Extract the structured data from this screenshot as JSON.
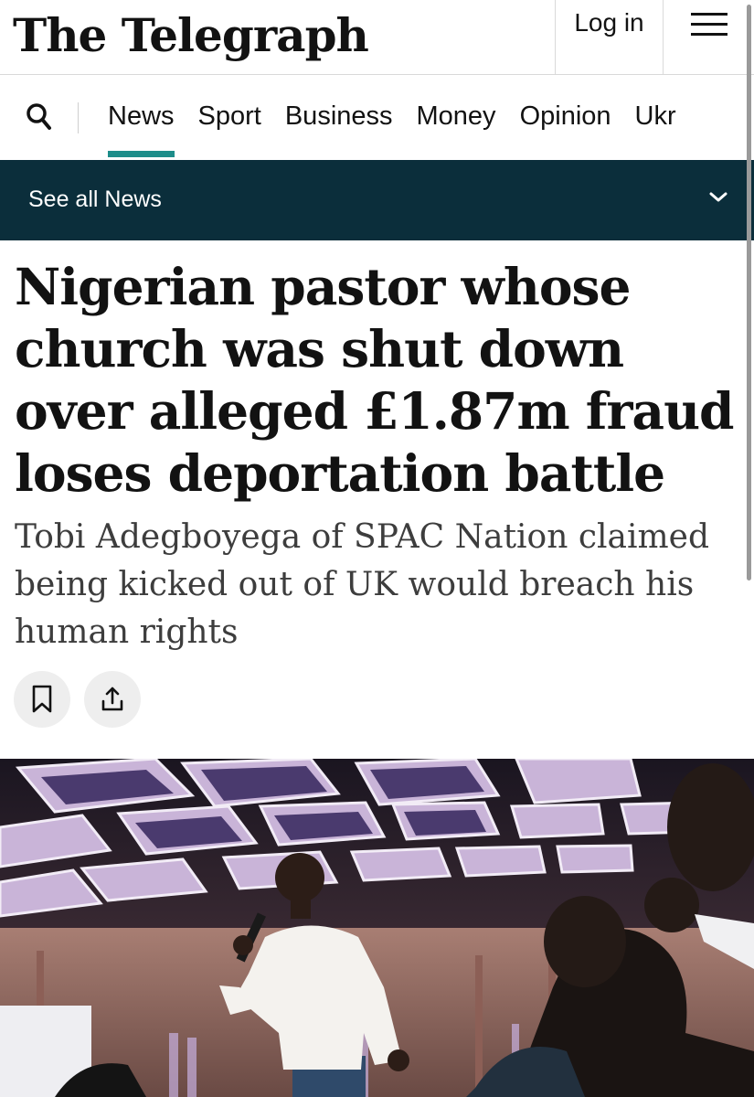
{
  "masthead": {
    "logo_text": "The Telegraph",
    "login_label": "Log in",
    "menu_icon": "hamburger-menu-icon"
  },
  "nav": {
    "search_icon": "search-icon",
    "items": [
      {
        "label": "News",
        "active": true
      },
      {
        "label": "Sport",
        "active": false
      },
      {
        "label": "Business",
        "active": false
      },
      {
        "label": "Money",
        "active": false
      },
      {
        "label": "Opinion",
        "active": false
      },
      {
        "label": "Ukr",
        "active": false
      }
    ],
    "accent_color": "#1d8d8a"
  },
  "section_bar": {
    "label": "See all News",
    "icon": "chevron-down-icon",
    "background": "#0b2e3b"
  },
  "article": {
    "headline": "Nigerian pastor whose church was shut down over alleged £1.87m fraud loses deportation battle",
    "standfirst": "Tobi Adegboyega of SPAC Nation claimed being kicked out of UK would breach his human rights",
    "actions": [
      {
        "icon": "bookmark-icon"
      },
      {
        "icon": "share-icon"
      }
    ],
    "hero_image": "photo-pastor-speaking-with-microphone-in-conference-hall"
  }
}
